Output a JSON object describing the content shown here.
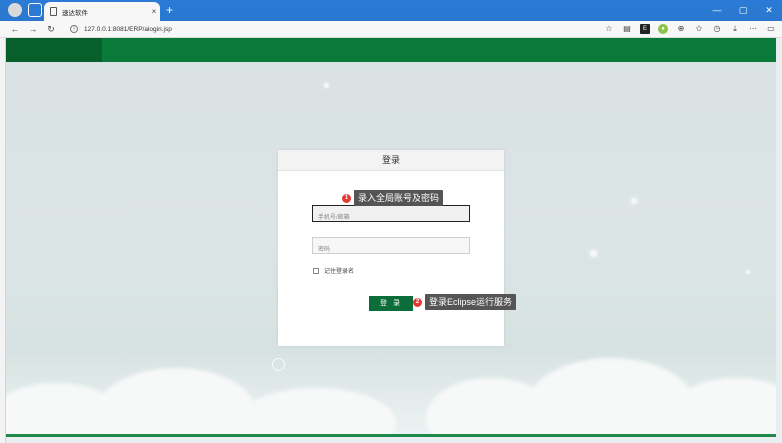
{
  "browser": {
    "tab_title": "速达软件",
    "tab_close": "×",
    "new_tab": "+",
    "url": "127.0.0.1:8081/ERP/alogin.jsp",
    "window_controls": [
      "—",
      "▢",
      "✕"
    ],
    "nav": [
      "←",
      "→",
      "↻"
    ],
    "toolbar_icons": [
      "star-icon",
      "reader-icon",
      "extension-a-icon",
      "extension-b-icon",
      "puzzle-icon",
      "favorites-icon",
      "history-icon",
      "download-icon",
      "more-icon",
      "sidebar-icon"
    ]
  },
  "login": {
    "title": "登录",
    "username_placeholder": "手机号/邮箱",
    "password_placeholder": "密码",
    "remember_label": "记住登录名",
    "submit_label": "登 录"
  },
  "annotations": [
    {
      "num": "1",
      "text": "录入全局账号及密码"
    },
    {
      "num": "2",
      "text": "登录Eclipse运行服务"
    }
  ],
  "colors": {
    "header_green": "#0a7a3a",
    "button_green": "#0b6e3a",
    "badge_red": "#e53935"
  }
}
